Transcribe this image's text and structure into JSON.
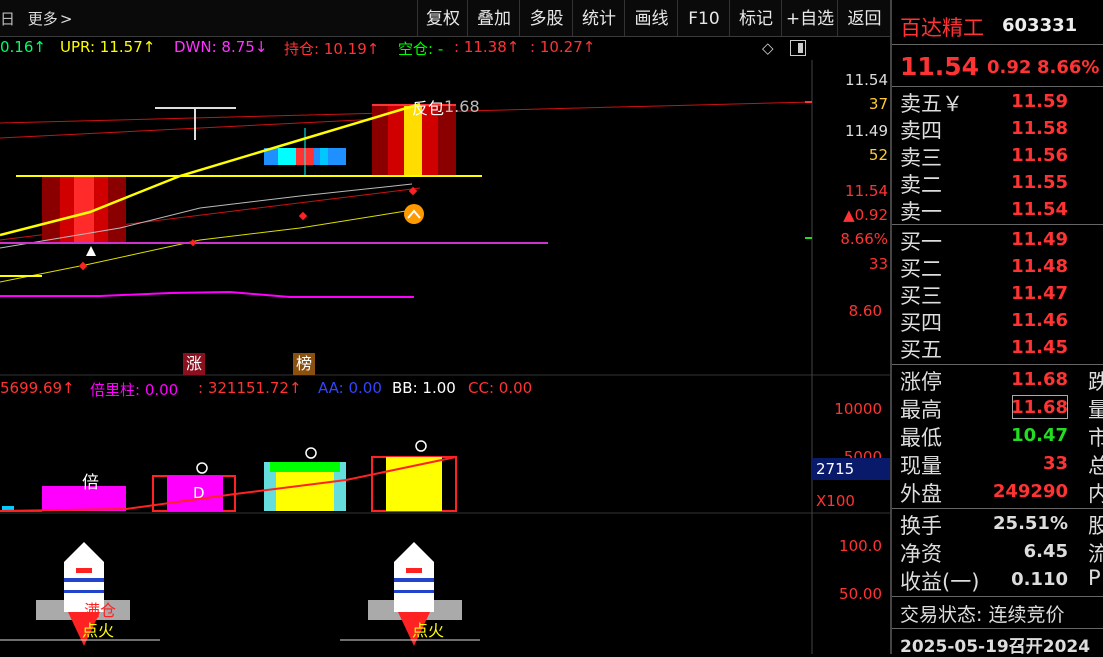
{
  "toolbar": {
    "left_fragment": "日",
    "more_label": "更多",
    "buttons": [
      "复权",
      "叠加",
      "多股",
      "统计",
      "画线",
      "F10",
      "标记",
      "+自选",
      "返回"
    ]
  },
  "main_indicators": {
    "frag": "0.16↑",
    "upr": "UPR: 11.57↑",
    "dwn": "DWN: 8.75↓",
    "hold": "持仓: 10.19↑",
    "empty": "空仓: -",
    "v1": ": 11.38↑",
    "v2": ": 10.27↑"
  },
  "chart_labels": {
    "peak_label": "1.68",
    "box_text": "反包",
    "zhang": "涨",
    "bang": "榜"
  },
  "right_axis_main": [
    "11.54",
    "37",
    "11.49",
    "52",
    "11.54",
    "▲0.92",
    "8.66%",
    "33",
    "8.60"
  ],
  "volume_indicators": {
    "frag": "5699.69↑",
    "beili": "倍里柱: 0.00",
    "v": ": 321151.72↑",
    "aa": "AA: 0.00",
    "bb": "BB: 1.00",
    "cc": "CC: 0.00"
  },
  "volume_labels": {
    "bei": "倍",
    "d": "D"
  },
  "right_axis_volume": [
    "10000",
    "5000",
    "2715",
    "X100"
  ],
  "bottom_labels": {
    "mancang": "满仓",
    "dianhuo1": "点火",
    "dianhuo2": "点火"
  },
  "right_axis_bottom": [
    "100.0",
    "50.00"
  ],
  "quote": {
    "name": "百达精工",
    "code": "603331",
    "price": "11.54",
    "change": "0.92",
    "pct": "8.66%",
    "asks": [
      {
        "label": "卖五￥",
        "price": "11.59"
      },
      {
        "label": "卖四",
        "price": "11.58"
      },
      {
        "label": "卖三",
        "price": "11.56"
      },
      {
        "label": "卖二",
        "price": "11.55"
      },
      {
        "label": "卖一",
        "price": "11.54"
      }
    ],
    "bids": [
      {
        "label": "买一",
        "price": "11.49"
      },
      {
        "label": "买二",
        "price": "11.48"
      },
      {
        "label": "买三",
        "price": "11.47"
      },
      {
        "label": "买四",
        "price": "11.46"
      },
      {
        "label": "买五",
        "price": "11.45"
      }
    ],
    "stats": [
      {
        "label": "涨停",
        "value": "11.68",
        "color": "#ff3333",
        "extra": "跌"
      },
      {
        "label": "最高",
        "value": "11.68",
        "color": "#ff3333",
        "extra": "量"
      },
      {
        "label": "最低",
        "value": "10.47",
        "color": "#22dd22",
        "extra": "市"
      },
      {
        "label": "现量",
        "value": "33",
        "color": "#ff3333",
        "extra": "总"
      },
      {
        "label": "外盘",
        "value": "249290",
        "color": "#ff3333",
        "extra": "内"
      }
    ],
    "stats2": [
      {
        "label": "换手",
        "value": "25.51%",
        "extra": "股"
      },
      {
        "label": "净资",
        "value": "6.45",
        "extra": "流"
      },
      {
        "label": "收益(一)",
        "value": "0.110",
        "extra": "P"
      }
    ],
    "status": "交易状态: 连续竞价",
    "footer": "2025-05-19召开2024"
  },
  "colors": {
    "up": "#ff3333",
    "down": "#22dd22",
    "yellow": "#ffff00",
    "magenta": "#ff00ff",
    "cyan": "#00ffff"
  }
}
